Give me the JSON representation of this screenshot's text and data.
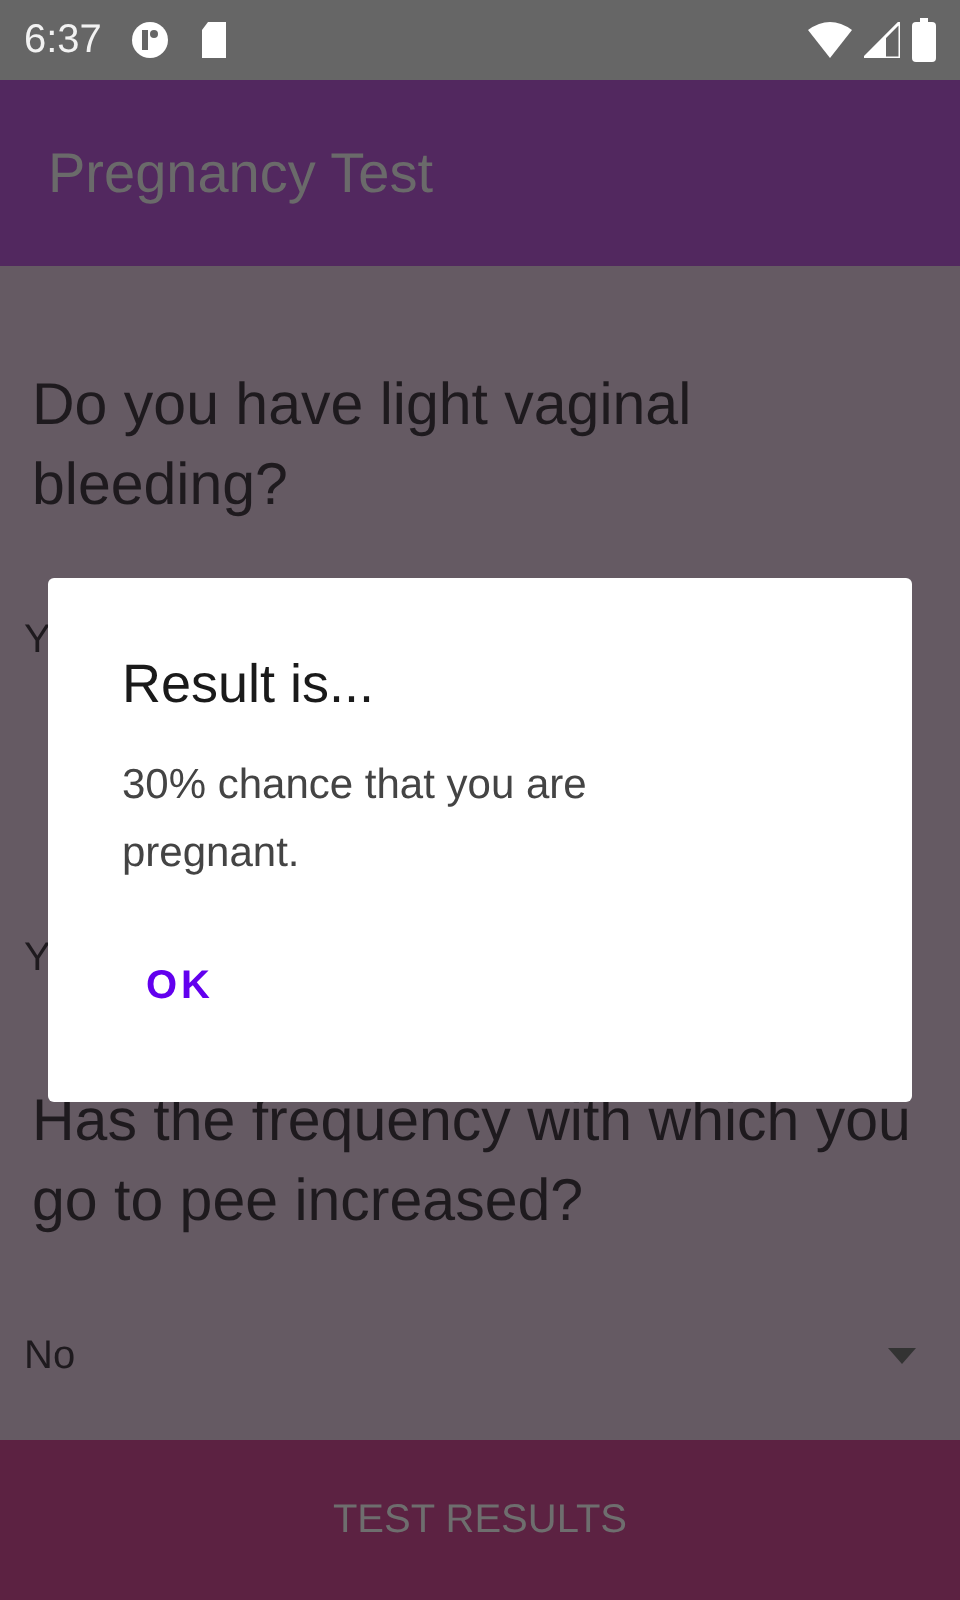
{
  "status_bar": {
    "time": "6:37"
  },
  "app_bar": {
    "title": "Pregnancy Test"
  },
  "questions": [
    {
      "text": "Do you have light vaginal bleeding?",
      "answer": {
        "kind": "covered",
        "value": "Y"
      }
    },
    {
      "answer": {
        "kind": "covered",
        "value": "Y"
      }
    },
    {
      "text": "Has the frequency with which you go to pee increased?",
      "answer": {
        "kind": "dropdown",
        "value": "No"
      }
    }
  ],
  "bottom_button": {
    "label": "TEST RESULTS"
  },
  "dialog": {
    "title": "Result is...",
    "message": "30% chance that you are pregnant.",
    "buttons": [
      "OK"
    ]
  }
}
